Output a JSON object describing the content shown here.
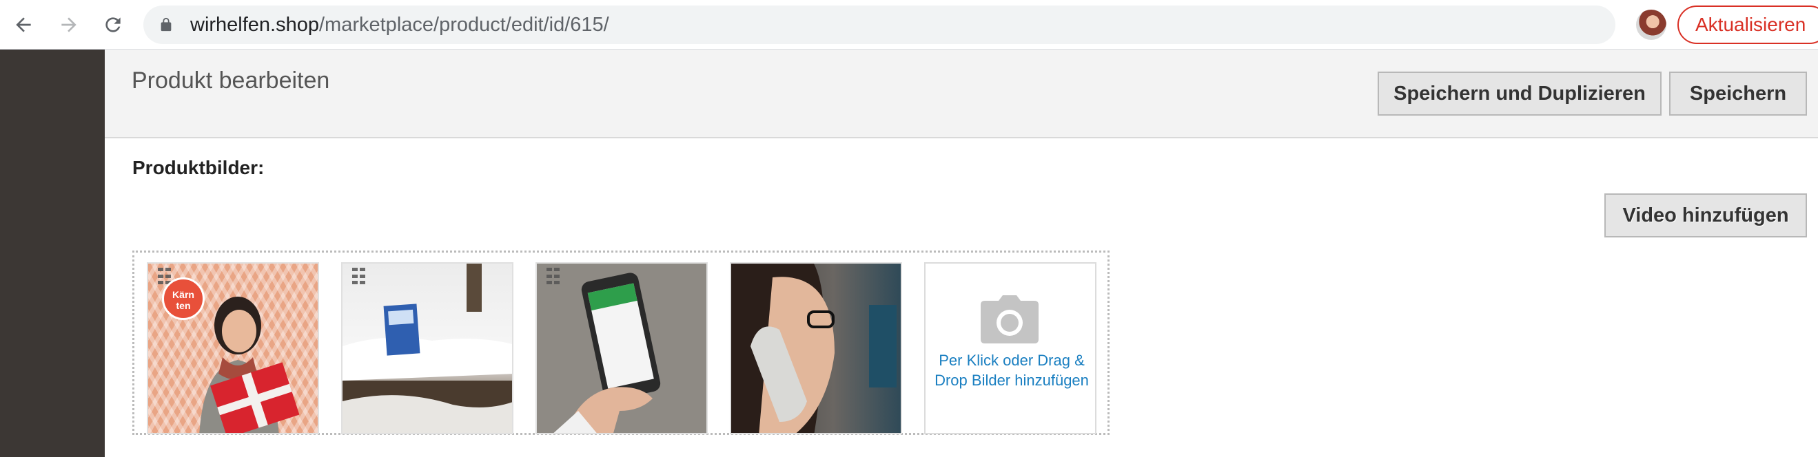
{
  "browser": {
    "url_domain": "wirhelfen.shop",
    "url_path": "/marketplace/product/edit/id/615/",
    "update_button": "Aktualisieren"
  },
  "page": {
    "title": "Produkt bearbeiten",
    "save_duplicate_button": "Speichern und Duplizieren",
    "save_button": "Speichern",
    "images_label": "Produktbilder:",
    "video_button": "Video hinzufügen",
    "upload_hint": "Per Klick oder Drag & Drop Bilder hinzufügen",
    "thumb1_badge": "Kärn ten"
  },
  "colors": {
    "sidebar": "#3c3734",
    "accent_red": "#d93025",
    "link_blue": "#1a7fc1"
  }
}
